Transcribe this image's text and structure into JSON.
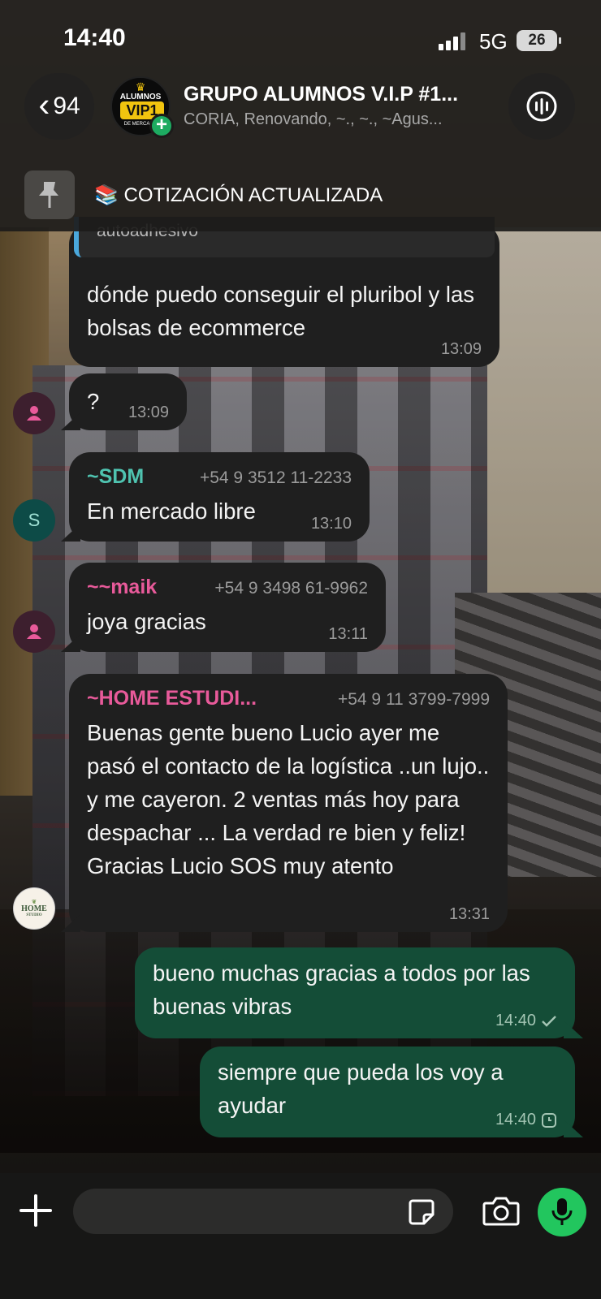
{
  "status_bar": {
    "time": "14:40",
    "network": "5G",
    "battery": "26"
  },
  "header": {
    "back_count": "94",
    "avatar_text": {
      "top": "ALUMNOS",
      "main": "VIP1",
      "bottom": "DE MERCADO"
    },
    "title": "GRUPO ALUMNOS V.I.P #1...",
    "subtitle": "CORIA, Renovando, ~., ~., ~Agus...",
    "pinned_message": "📚 COTIZACIÓN ACTUALIZADA"
  },
  "messages": [
    {
      "quoted": "autoadhesivo",
      "text": "dónde puedo conseguir el pluribol y las bolsas de ecommerce",
      "time": "13:09"
    },
    {
      "text": "?",
      "time": "13:09"
    },
    {
      "sender": "~SDM",
      "sender_color": "#4fc3b0",
      "phone": "+54 9 3512 11-2233",
      "avatar_letter": "S",
      "text": "En mercado libre",
      "time": "13:10"
    },
    {
      "sender": "~~maik",
      "sender_color": "#e85a9a",
      "phone": "+54 9 3498 61-9962",
      "text": "joya gracias",
      "time": "13:11"
    },
    {
      "sender": "~HOME ESTUDI...",
      "sender_color": "#e85a9a",
      "phone": "+54 9 11 3799-7999",
      "text": "Buenas gente bueno Lucio ayer me pasó el contacto de la logística ..un lujo.. y me cayeron. 2 ventas más hoy para despachar ... La verdad re bien y feliz! Gracias Lucio SOS muy atento",
      "time": "13:31",
      "avatar_text": {
        "top": "HOME",
        "bottom": "STUDIO"
      }
    },
    {
      "outgoing": true,
      "text": "bueno muchas gracias a todos por las buenas vibras",
      "time": "14:40",
      "status": "sent"
    },
    {
      "outgoing": true,
      "text": "siempre que pueda los voy a ayudar",
      "time": "14:40",
      "status": "pending"
    }
  ],
  "colors": {
    "accent_green": "#22c65e",
    "outgoing_bubble": "#144d37",
    "incoming_bubble": "#1f1f1f"
  },
  "icons": [
    "chevron-left-icon",
    "plus-icon",
    "voice-call-icon",
    "pin-icon",
    "user-icon",
    "sticker-icon",
    "camera-icon",
    "microphone-icon",
    "check-icon",
    "clock-icon"
  ]
}
